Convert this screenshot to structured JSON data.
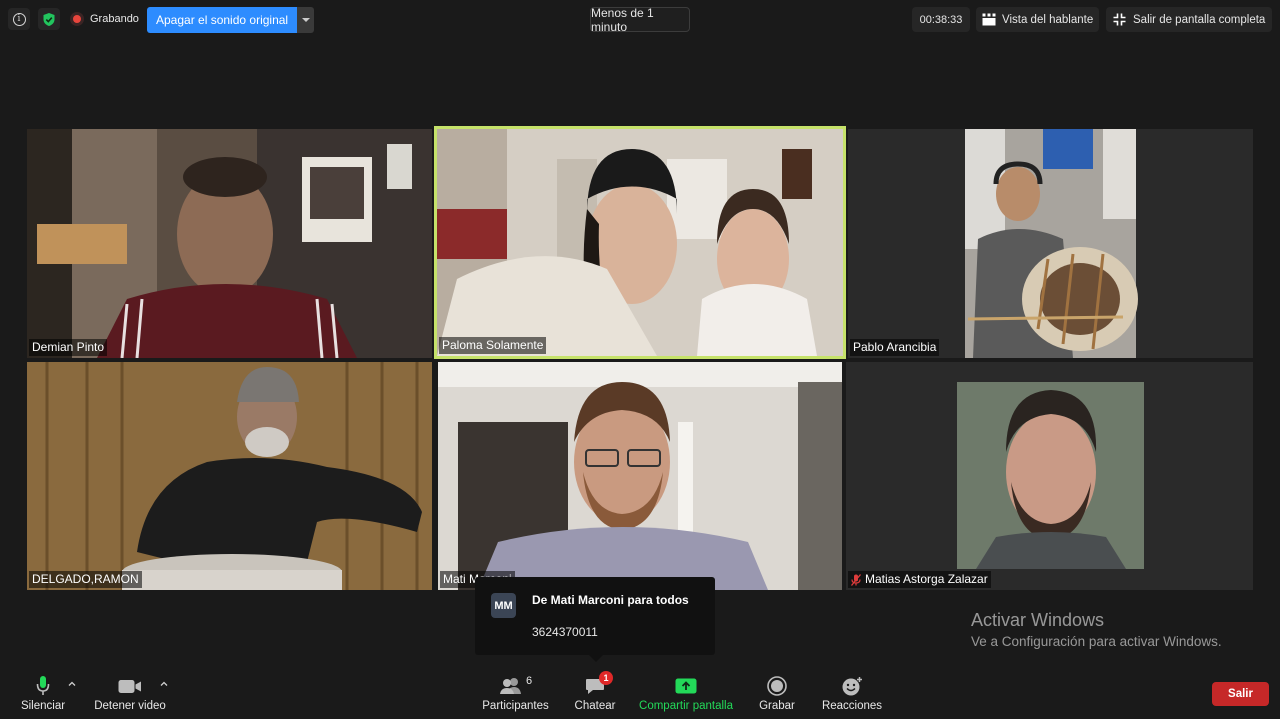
{
  "topbar": {
    "recording_label": "Grabando",
    "original_sound_label": "Apagar el sonido original",
    "timer_label": "Menos de 1 minuto",
    "elapsed": "00:38:33",
    "speaker_view_label": "Vista del hablante",
    "exit_fullscreen_label": "Salir de pantalla completa"
  },
  "participants": [
    {
      "name": "Demian Pinto"
    },
    {
      "name": "Paloma Solamente"
    },
    {
      "name": "Pablo Arancibia"
    },
    {
      "name": "DELGADO,RAMON"
    },
    {
      "name": "Mati Marconi"
    },
    {
      "name": "Matias Astorga Zalazar"
    }
  ],
  "active_speaker": "Paloma Solamente",
  "chat_popup": {
    "avatar_initials": "MM",
    "from": "De Mati Marconi para todos",
    "message": "3624370011"
  },
  "watermark": {
    "title": "Activar Windows",
    "subtitle": "Ve a Configuración para activar Windows."
  },
  "toolbar": {
    "mute_label": "Silenciar",
    "video_label": "Detener video",
    "participants_label": "Participantes",
    "participants_count": "6",
    "chat_label": "Chatear",
    "chat_badge": "1",
    "share_label": "Compartir pantalla",
    "record_label": "Grabar",
    "reactions_label": "Reacciones",
    "leave_label": "Salir"
  },
  "colors": {
    "share_green": "#23d959",
    "active_border": "#c6e26a",
    "leave_red": "#c62828",
    "accent_blue": "#2d8cff"
  }
}
